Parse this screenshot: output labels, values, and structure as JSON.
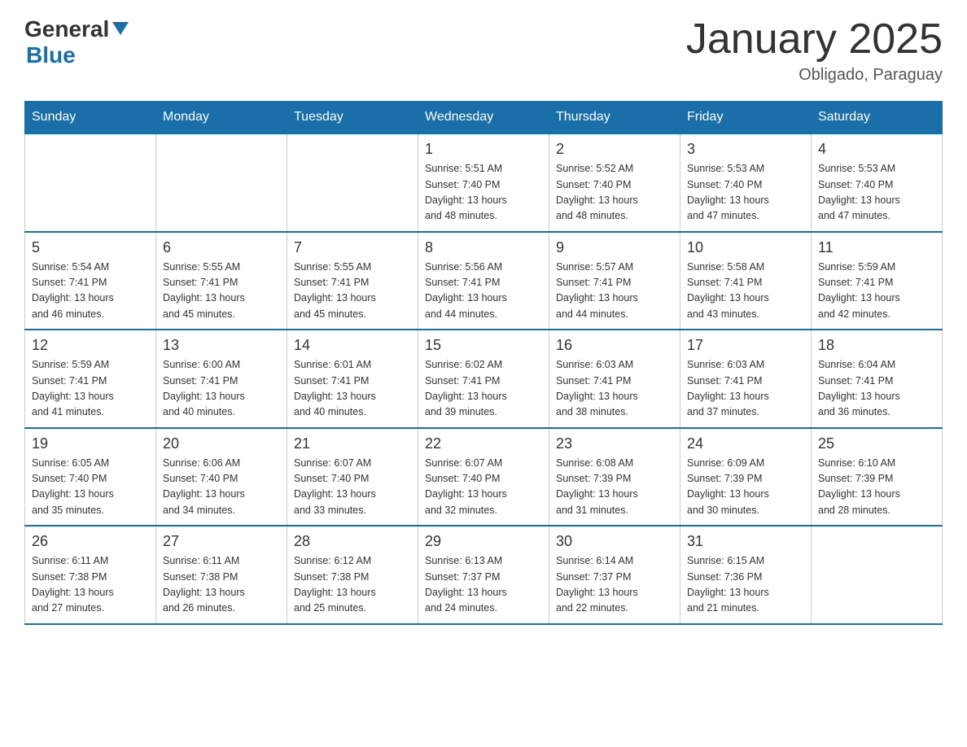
{
  "logo": {
    "general": "General",
    "blue": "Blue"
  },
  "title": "January 2025",
  "location": "Obligado, Paraguay",
  "days_header": [
    "Sunday",
    "Monday",
    "Tuesday",
    "Wednesday",
    "Thursday",
    "Friday",
    "Saturday"
  ],
  "weeks": [
    [
      {
        "day": "",
        "info": ""
      },
      {
        "day": "",
        "info": ""
      },
      {
        "day": "",
        "info": ""
      },
      {
        "day": "1",
        "info": "Sunrise: 5:51 AM\nSunset: 7:40 PM\nDaylight: 13 hours\nand 48 minutes."
      },
      {
        "day": "2",
        "info": "Sunrise: 5:52 AM\nSunset: 7:40 PM\nDaylight: 13 hours\nand 48 minutes."
      },
      {
        "day": "3",
        "info": "Sunrise: 5:53 AM\nSunset: 7:40 PM\nDaylight: 13 hours\nand 47 minutes."
      },
      {
        "day": "4",
        "info": "Sunrise: 5:53 AM\nSunset: 7:40 PM\nDaylight: 13 hours\nand 47 minutes."
      }
    ],
    [
      {
        "day": "5",
        "info": "Sunrise: 5:54 AM\nSunset: 7:41 PM\nDaylight: 13 hours\nand 46 minutes."
      },
      {
        "day": "6",
        "info": "Sunrise: 5:55 AM\nSunset: 7:41 PM\nDaylight: 13 hours\nand 45 minutes."
      },
      {
        "day": "7",
        "info": "Sunrise: 5:55 AM\nSunset: 7:41 PM\nDaylight: 13 hours\nand 45 minutes."
      },
      {
        "day": "8",
        "info": "Sunrise: 5:56 AM\nSunset: 7:41 PM\nDaylight: 13 hours\nand 44 minutes."
      },
      {
        "day": "9",
        "info": "Sunrise: 5:57 AM\nSunset: 7:41 PM\nDaylight: 13 hours\nand 44 minutes."
      },
      {
        "day": "10",
        "info": "Sunrise: 5:58 AM\nSunset: 7:41 PM\nDaylight: 13 hours\nand 43 minutes."
      },
      {
        "day": "11",
        "info": "Sunrise: 5:59 AM\nSunset: 7:41 PM\nDaylight: 13 hours\nand 42 minutes."
      }
    ],
    [
      {
        "day": "12",
        "info": "Sunrise: 5:59 AM\nSunset: 7:41 PM\nDaylight: 13 hours\nand 41 minutes."
      },
      {
        "day": "13",
        "info": "Sunrise: 6:00 AM\nSunset: 7:41 PM\nDaylight: 13 hours\nand 40 minutes."
      },
      {
        "day": "14",
        "info": "Sunrise: 6:01 AM\nSunset: 7:41 PM\nDaylight: 13 hours\nand 40 minutes."
      },
      {
        "day": "15",
        "info": "Sunrise: 6:02 AM\nSunset: 7:41 PM\nDaylight: 13 hours\nand 39 minutes."
      },
      {
        "day": "16",
        "info": "Sunrise: 6:03 AM\nSunset: 7:41 PM\nDaylight: 13 hours\nand 38 minutes."
      },
      {
        "day": "17",
        "info": "Sunrise: 6:03 AM\nSunset: 7:41 PM\nDaylight: 13 hours\nand 37 minutes."
      },
      {
        "day": "18",
        "info": "Sunrise: 6:04 AM\nSunset: 7:41 PM\nDaylight: 13 hours\nand 36 minutes."
      }
    ],
    [
      {
        "day": "19",
        "info": "Sunrise: 6:05 AM\nSunset: 7:40 PM\nDaylight: 13 hours\nand 35 minutes."
      },
      {
        "day": "20",
        "info": "Sunrise: 6:06 AM\nSunset: 7:40 PM\nDaylight: 13 hours\nand 34 minutes."
      },
      {
        "day": "21",
        "info": "Sunrise: 6:07 AM\nSunset: 7:40 PM\nDaylight: 13 hours\nand 33 minutes."
      },
      {
        "day": "22",
        "info": "Sunrise: 6:07 AM\nSunset: 7:40 PM\nDaylight: 13 hours\nand 32 minutes."
      },
      {
        "day": "23",
        "info": "Sunrise: 6:08 AM\nSunset: 7:39 PM\nDaylight: 13 hours\nand 31 minutes."
      },
      {
        "day": "24",
        "info": "Sunrise: 6:09 AM\nSunset: 7:39 PM\nDaylight: 13 hours\nand 30 minutes."
      },
      {
        "day": "25",
        "info": "Sunrise: 6:10 AM\nSunset: 7:39 PM\nDaylight: 13 hours\nand 28 minutes."
      }
    ],
    [
      {
        "day": "26",
        "info": "Sunrise: 6:11 AM\nSunset: 7:38 PM\nDaylight: 13 hours\nand 27 minutes."
      },
      {
        "day": "27",
        "info": "Sunrise: 6:11 AM\nSunset: 7:38 PM\nDaylight: 13 hours\nand 26 minutes."
      },
      {
        "day": "28",
        "info": "Sunrise: 6:12 AM\nSunset: 7:38 PM\nDaylight: 13 hours\nand 25 minutes."
      },
      {
        "day": "29",
        "info": "Sunrise: 6:13 AM\nSunset: 7:37 PM\nDaylight: 13 hours\nand 24 minutes."
      },
      {
        "day": "30",
        "info": "Sunrise: 6:14 AM\nSunset: 7:37 PM\nDaylight: 13 hours\nand 22 minutes."
      },
      {
        "day": "31",
        "info": "Sunrise: 6:15 AM\nSunset: 7:36 PM\nDaylight: 13 hours\nand 21 minutes."
      },
      {
        "day": "",
        "info": ""
      }
    ]
  ]
}
